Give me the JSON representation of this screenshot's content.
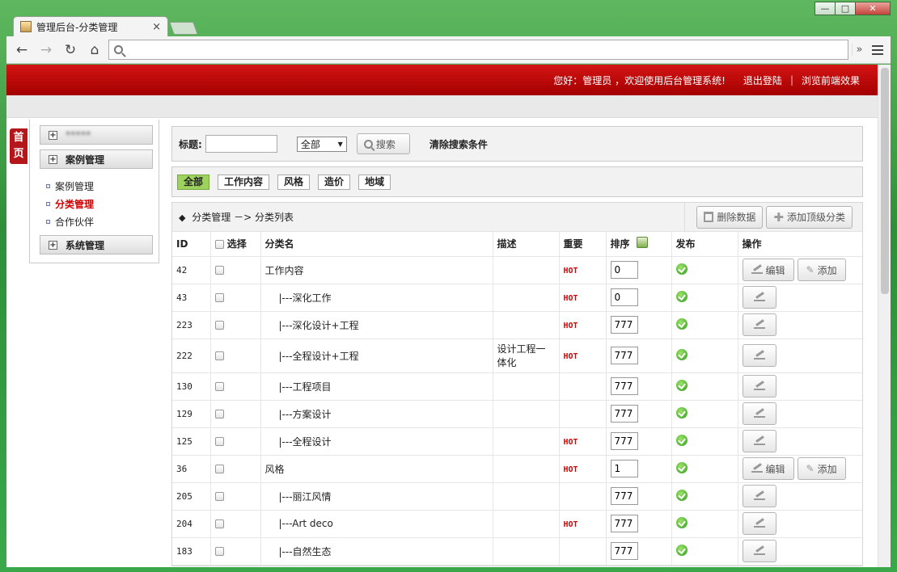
{
  "browser": {
    "tab_title": "管理后台-分类管理",
    "url": "",
    "window_buttons": {
      "minimize": "—",
      "maximize": "□",
      "close": "✕"
    },
    "nav": {
      "back": "←",
      "forward": "→",
      "reload": "↻",
      "home": "⌂",
      "more": "»"
    }
  },
  "topbar": {
    "greeting": "您好：管理员 ，欢迎使用后台管理系统!",
    "logout": "退出登陆",
    "sep": "|",
    "frontend": "浏览前端效果"
  },
  "home_tab": {
    "char1": "首",
    "char2": "页"
  },
  "sidebar": {
    "group_blurred": "*****",
    "groups": [
      {
        "label": "案例管理",
        "plus": "+"
      },
      {
        "label": "系统管理",
        "plus": "+"
      }
    ],
    "items": [
      {
        "label": "案例管理"
      },
      {
        "label": "分类管理"
      },
      {
        "label": "合作伙伴"
      }
    ]
  },
  "search": {
    "title_label": "标题:",
    "title_value": "",
    "select_value": "全部",
    "select_arrow": "▼",
    "search_button": "搜索",
    "clear": "清除搜索条件"
  },
  "filters": [
    "全部",
    "工作内容",
    "风格",
    "造价",
    "地域"
  ],
  "list": {
    "diamond": "◆",
    "breadcrumb": "分类管理 －> 分类列表",
    "delete_button": "删除数据",
    "add_top_button": "添加顶级分类",
    "plus_sign": "✚",
    "columns": {
      "id": "ID",
      "select": "选择",
      "name": "分类名",
      "desc": "描述",
      "important": "重要",
      "sort": "排序",
      "publish": "发布",
      "action": "操作"
    },
    "edit_label": "编辑",
    "add_label": "添加",
    "wand_icon": "✎",
    "rows": [
      {
        "id": "42",
        "name": "工作内容",
        "indent": false,
        "desc": "",
        "hot": "HOT",
        "sort": "0",
        "parent": true
      },
      {
        "id": "43",
        "name": "|---深化工作",
        "indent": true,
        "desc": "",
        "hot": "HOT",
        "sort": "0",
        "parent": false
      },
      {
        "id": "223",
        "name": "|---深化设计+工程",
        "indent": true,
        "desc": "",
        "hot": "HOT",
        "sort": "777",
        "parent": false
      },
      {
        "id": "222",
        "name": "|---全程设计+工程",
        "indent": true,
        "desc": "设计工程一体化",
        "hot": "HOT",
        "sort": "777",
        "parent": false
      },
      {
        "id": "130",
        "name": "|---工程项目",
        "indent": true,
        "desc": "",
        "hot": "",
        "sort": "777",
        "parent": false
      },
      {
        "id": "129",
        "name": "|---方案设计",
        "indent": true,
        "desc": "",
        "hot": "",
        "sort": "777",
        "parent": false
      },
      {
        "id": "125",
        "name": "|---全程设计",
        "indent": true,
        "desc": "",
        "hot": "HOT",
        "sort": "777",
        "parent": false
      },
      {
        "id": "36",
        "name": "风格",
        "indent": false,
        "desc": "",
        "hot": "HOT",
        "sort": "1",
        "parent": true
      },
      {
        "id": "205",
        "name": "|---丽江风情",
        "indent": true,
        "desc": "",
        "hot": "",
        "sort": "777",
        "parent": false
      },
      {
        "id": "204",
        "name": "|---Art deco",
        "indent": true,
        "desc": "",
        "hot": "HOT",
        "sort": "777",
        "parent": false
      },
      {
        "id": "183",
        "name": "|---自然生态",
        "indent": true,
        "desc": "",
        "hot": "",
        "sort": "777",
        "parent": false
      }
    ]
  },
  "colors": {
    "topbar_red": "#c40c0c",
    "active_red": "#d20000",
    "filter_green": "#9ed25e",
    "hot_red": "#dd0000"
  }
}
